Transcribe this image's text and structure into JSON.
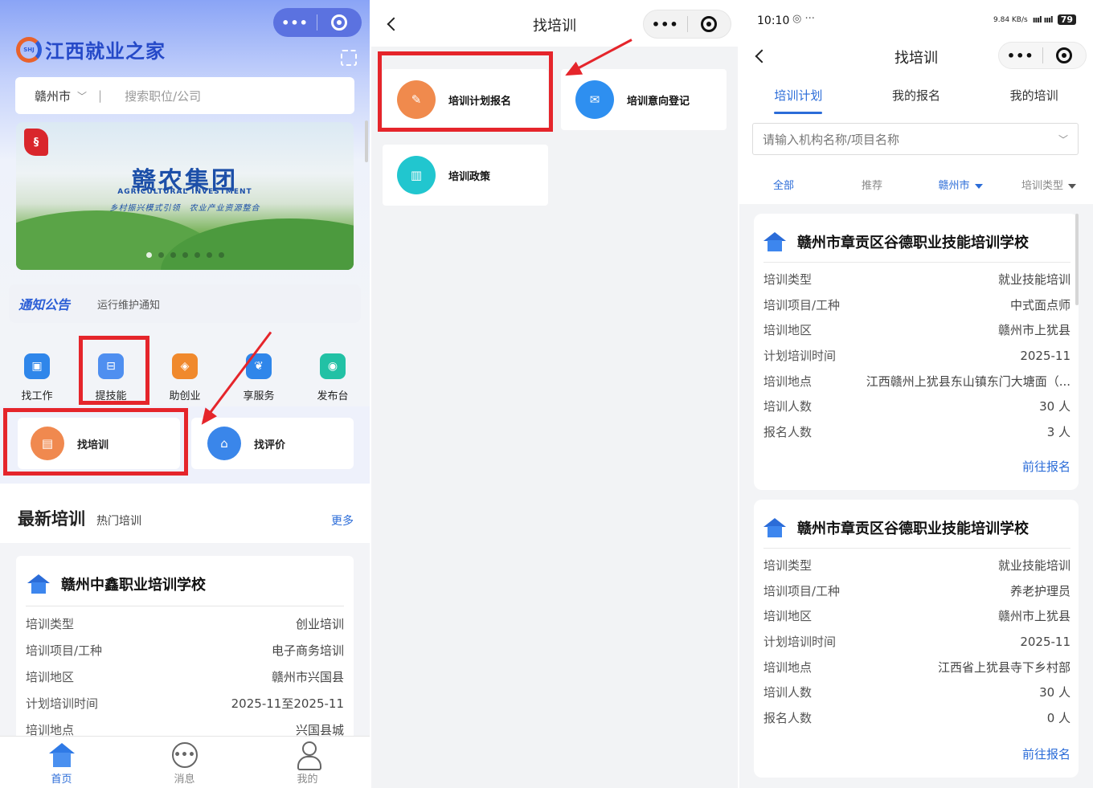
{
  "panel1": {
    "app_name": "江西就业之家",
    "logo_small": "SHJ",
    "city": "赣州市",
    "search_placeholder": "搜索职位/公司",
    "banner": {
      "title": "赣农集团",
      "en": "AGRICULTURAL INVESTMENT",
      "subtitle": "乡村振兴模式引领　农业产业资源整合"
    },
    "notice": {
      "tag": "通知公告",
      "text": "运行维护通知"
    },
    "tiles": [
      {
        "label": "找工作",
        "icon": "briefcase-icon",
        "color": "#2f86ea",
        "glyph": "▣"
      },
      {
        "label": "提技能",
        "icon": "skill-icon",
        "color": "#2f86ea",
        "glyph": "⊟"
      },
      {
        "label": "助创业",
        "icon": "startup-icon",
        "color": "#f0892d",
        "glyph": "◈"
      },
      {
        "label": "享服务",
        "icon": "service-icon",
        "color": "#2f86ea",
        "glyph": "❦"
      },
      {
        "label": "发布台",
        "icon": "publish-icon",
        "color": "#22c1a5",
        "glyph": "◉"
      }
    ],
    "subtiles": [
      {
        "label": "找培训",
        "icon": "training-icon",
        "color": "#f0894f",
        "glyph": "▤"
      },
      {
        "label": "找评价",
        "icon": "evaluation-icon",
        "color": "#3a86ea",
        "glyph": "⌂"
      }
    ],
    "latest": {
      "title": "最新培训",
      "subtitle": "热门培训",
      "more": "更多",
      "org": "赣州中鑫职业培训学校",
      "rows": [
        {
          "k": "培训类型",
          "v": "创业培训"
        },
        {
          "k": "培训项目/工种",
          "v": "电子商务培训"
        },
        {
          "k": "培训地区",
          "v": "赣州市兴国县"
        },
        {
          "k": "计划培训时间",
          "v": "2025-11至2025-11"
        },
        {
          "k": "培训地点",
          "v": "兴国县城"
        }
      ]
    },
    "tabbar": [
      {
        "label": "首页",
        "icon": "home-icon",
        "active": true
      },
      {
        "label": "消息",
        "icon": "message-icon",
        "active": false
      },
      {
        "label": "我的",
        "icon": "profile-icon",
        "active": false
      }
    ]
  },
  "panel2": {
    "title": "找培训",
    "cards": [
      {
        "label": "培训计划报名",
        "icon": "plan-signup-icon",
        "color": "#f08a4d",
        "glyph": "✎"
      },
      {
        "label": "培训意向登记",
        "icon": "intent-register-icon",
        "color": "#2e8ff0",
        "glyph": "✉"
      },
      {
        "label": "培训政策",
        "icon": "policy-icon",
        "color": "#21c6cf",
        "glyph": "▥"
      }
    ]
  },
  "panel3": {
    "status_time": "10:10",
    "status_misc": "◎ ···",
    "net_speed": "9.84 KB/s",
    "signal": "ıııl ıııl",
    "battery": "79",
    "title": "找培训",
    "tabs": [
      "培训计划",
      "我的报名",
      "我的培训"
    ],
    "search_placeholder": "请输入机构名称/项目名称",
    "filters": [
      "全部",
      "推荐",
      "赣州市",
      "培训类型"
    ],
    "cards": [
      {
        "org": "赣州市章贡区谷德职业技能培训学校",
        "rows": [
          {
            "k": "培训类型",
            "v": "就业技能培训"
          },
          {
            "k": "培训项目/工种",
            "v": "中式面点师"
          },
          {
            "k": "培训地区",
            "v": "赣州市上犹县"
          },
          {
            "k": "计划培训时间",
            "v": "2025-11"
          },
          {
            "k": "培训地点",
            "v": "江西赣州上犹县东山镇东门大塘面（..."
          },
          {
            "k": "培训人数",
            "v": "30 人"
          },
          {
            "k": "报名人数",
            "v": "3 人"
          }
        ],
        "action": "前往报名"
      },
      {
        "org": "赣州市章贡区谷德职业技能培训学校",
        "rows": [
          {
            "k": "培训类型",
            "v": "就业技能培训"
          },
          {
            "k": "培训项目/工种",
            "v": "养老护理员"
          },
          {
            "k": "培训地区",
            "v": "赣州市上犹县"
          },
          {
            "k": "计划培训时间",
            "v": "2025-11"
          },
          {
            "k": "培训地点",
            "v": "江西省上犹县寺下乡村部"
          },
          {
            "k": "培训人数",
            "v": "30 人"
          },
          {
            "k": "报名人数",
            "v": "0 人"
          }
        ],
        "action": "前往报名"
      }
    ]
  },
  "capsule": {
    "dots": "•••"
  }
}
